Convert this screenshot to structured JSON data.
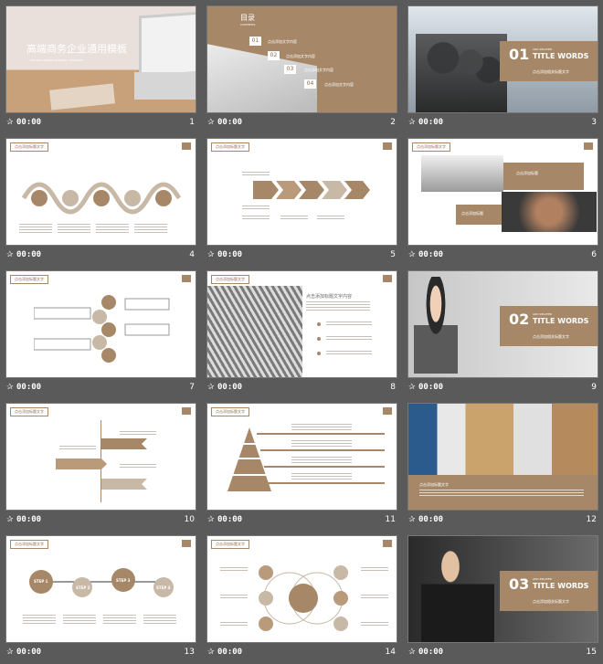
{
  "colors": {
    "accent": "#a68868",
    "dark_accent": "#8a6d4e",
    "page_bg": "#5a5a5a"
  },
  "slides": [
    {
      "num": "1",
      "time": "00:00",
      "title": "高端商务企业通用模板",
      "subtitle": "CUSTOM DESIGN BUSINESS TEMPLATE"
    },
    {
      "num": "2",
      "time": "00:00",
      "toc_title": "目录",
      "toc_en": "CONTENTS",
      "items": [
        {
          "n": "01",
          "t": "点击添加文字内容"
        },
        {
          "n": "02",
          "t": "点击添加文字内容"
        },
        {
          "n": "03",
          "t": "点击添加文字内容"
        },
        {
          "n": "04",
          "t": "点击添加文字内容"
        }
      ]
    },
    {
      "num": "3",
      "time": "00:00",
      "sec_num": "01",
      "sec_small": "ADD RELATED",
      "sec_big": "TITLE WORDS",
      "sec_sub": "点击添加相关标题文字"
    },
    {
      "num": "4",
      "time": "00:00",
      "header": "点击添加标题文字"
    },
    {
      "num": "5",
      "time": "00:00",
      "header": "点击添加标题文字"
    },
    {
      "num": "6",
      "time": "00:00",
      "header": "点击添加标题文字",
      "label1": "点击添加标题",
      "label2": "点击添加标题"
    },
    {
      "num": "7",
      "time": "00:00",
      "header": "点击添加标题文字"
    },
    {
      "num": "8",
      "time": "00:00",
      "header": "点击添加标题文字",
      "title": "点击添加标题文字内容"
    },
    {
      "num": "9",
      "time": "00:00",
      "sec_num": "02",
      "sec_small": "ADD RELATED",
      "sec_big": "TITLE WORDS",
      "sec_sub": "点击添加相关标题文字"
    },
    {
      "num": "10",
      "time": "00:00",
      "header": "点击添加标题文字"
    },
    {
      "num": "11",
      "time": "00:00",
      "header": "点击添加标题文字"
    },
    {
      "num": "12",
      "time": "00:00",
      "caption": "点击添加标题文字"
    },
    {
      "num": "13",
      "time": "00:00",
      "header": "点击添加标题文字",
      "steps": [
        "STEP 1",
        "STEP 2",
        "STEP 3",
        "STEP 4"
      ]
    },
    {
      "num": "14",
      "time": "00:00",
      "header": "点击添加标题文字"
    },
    {
      "num": "15",
      "time": "00:00",
      "sec_num": "03",
      "sec_small": "ADD RELATED",
      "sec_big": "TITLE WORDS",
      "sec_sub": "点击添加相关标题文字"
    }
  ]
}
